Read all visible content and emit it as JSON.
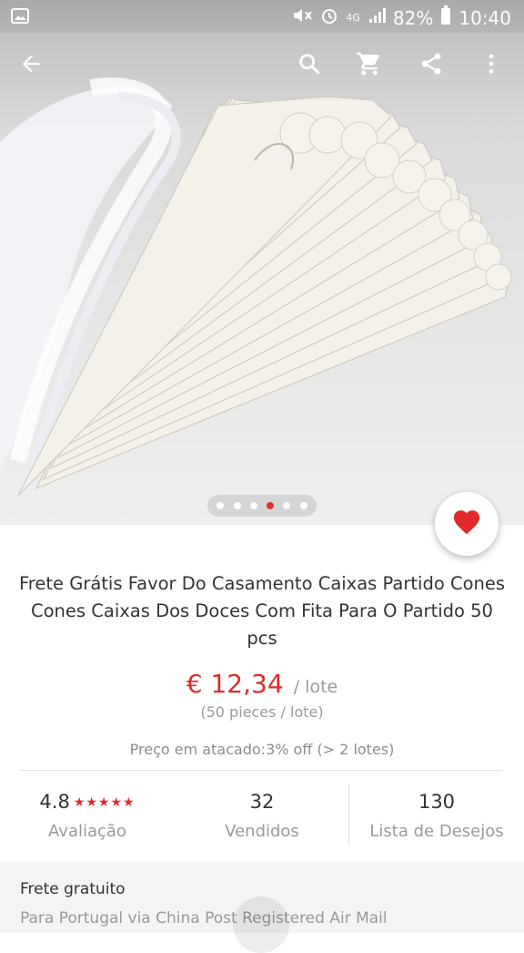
{
  "status_bar": {
    "battery": "82%",
    "time": "10:40",
    "network": "4G"
  },
  "toolbar": {
    "back_icon": "arrow-left-icon",
    "search_icon": "search-icon",
    "cart_icon": "cart-icon",
    "share_icon": "share-icon",
    "more_icon": "more-vert-icon"
  },
  "gallery": {
    "total_images": 6,
    "active_index": 4
  },
  "product": {
    "title": "Frete Grátis Favor Do Casamento Caixas Partido Cones Cones Caixas Dos Doces Com Fita Para O Partido 50 pcs",
    "price": "€ 12,34",
    "price_unit": "/ lote",
    "pieces": "(50 pieces / lote)",
    "wholesale": "Preço em atacado:3% off (> 2 lotes)"
  },
  "stats": {
    "rating_value": "4.8",
    "rating_stars": "★★★★★",
    "rating_label": "Avaliação",
    "sold_value": "32",
    "sold_label": "Vendidos",
    "wishlist_value": "130",
    "wishlist_label": "Lista de Desejos"
  },
  "shipping": {
    "title": "Frete gratuito",
    "subtitle": "Para Portugal via China Post Registered Air Mail"
  },
  "colors": {
    "accent": "#e12b2b",
    "active_dot": "#e6332a"
  }
}
